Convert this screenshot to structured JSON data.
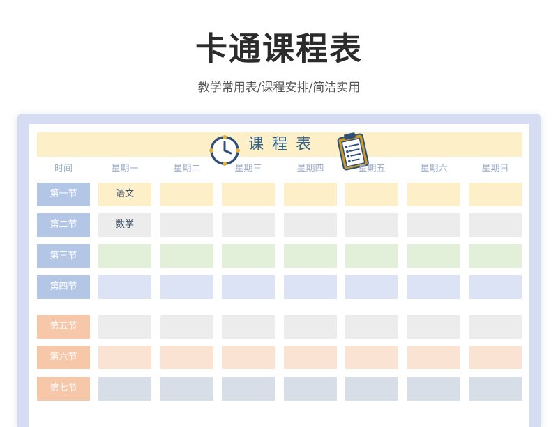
{
  "page": {
    "title": "卡通课程表",
    "subtitle": "教学常用表/课程安排/简洁实用"
  },
  "schedule": {
    "banner_title": "课程表",
    "icons": [
      "clock-icon",
      "clipboard-icon"
    ],
    "header": [
      "时间",
      "星期一",
      "星期二",
      "星期三",
      "星期四",
      "星期五",
      "星期六",
      "星期日"
    ],
    "rows": [
      {
        "label": "第一节",
        "color": "#fdf0c9",
        "cells": [
          "语文",
          "",
          "",
          "",
          "",
          "",
          ""
        ]
      },
      {
        "label": "第二节",
        "color": "#ececec",
        "cells": [
          "数学",
          "",
          "",
          "",
          "",
          "",
          ""
        ]
      },
      {
        "label": "第三节",
        "color": "#e2efd9",
        "cells": [
          "",
          "",
          "",
          "",
          "",
          "",
          ""
        ]
      },
      {
        "label": "第四节",
        "color": "#dce3f5",
        "cells": [
          "",
          "",
          "",
          "",
          "",
          "",
          ""
        ]
      },
      {
        "label": "第五节",
        "color": "#ececec",
        "cells": [
          "",
          "",
          "",
          "",
          "",
          "",
          ""
        ]
      },
      {
        "label": "第六节",
        "color": "#fbe3d4",
        "cells": [
          "",
          "",
          "",
          "",
          "",
          "",
          ""
        ]
      },
      {
        "label": "第七节",
        "color": "#d7dee8",
        "cells": [
          "",
          "",
          "",
          "",
          "",
          "",
          ""
        ]
      }
    ],
    "colors": {
      "morning_period": "#b4c6e6",
      "afternoon_period": "#f6c7a8",
      "card_background": "#d6ddf3",
      "banner": "#fdf0c9",
      "title_accent": "#2f6190"
    }
  }
}
